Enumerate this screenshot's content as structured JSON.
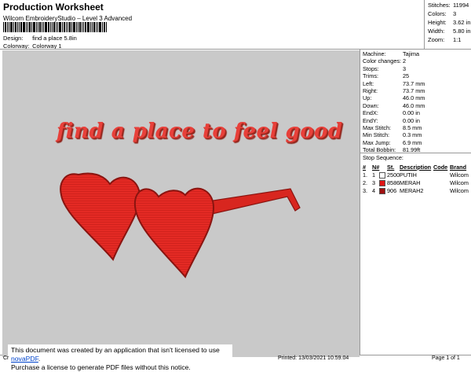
{
  "header": {
    "title": "Production Worksheet",
    "subtitle": "Wilcom EmbroideryStudio – Level 3 Advanced"
  },
  "design_info": {
    "design_label": "Design:",
    "design_value": "find a place 5.8in",
    "colorway_label": "Colorway:",
    "colorway_value": "Colorway 1"
  },
  "stats": [
    {
      "label": "Stitches:",
      "value": "11994"
    },
    {
      "label": "Colors:",
      "value": "3"
    },
    {
      "label": "Height:",
      "value": "3.62 in"
    },
    {
      "label": "Width:",
      "value": "5.80 in"
    },
    {
      "label": "Zoom:",
      "value": "1:1"
    }
  ],
  "design_text": "find a place to feel good",
  "machine_info": [
    {
      "label": "Machine:",
      "value": "Tajima"
    },
    {
      "label": "Color changes:",
      "value": "2"
    },
    {
      "label": "Stops:",
      "value": "3"
    },
    {
      "label": "Trims:",
      "value": "25"
    },
    {
      "label": "Left:",
      "value": "73.7 mm"
    },
    {
      "label": "Right:",
      "value": "73.7 mm"
    },
    {
      "label": "Up:",
      "value": "46.0 mm"
    },
    {
      "label": "Down:",
      "value": "46.0 mm"
    },
    {
      "label": "EndX:",
      "value": "0.00 in"
    },
    {
      "label": "EndY:",
      "value": "0.00 in"
    },
    {
      "label": "Max Stitch:",
      "value": "8.5 mm"
    },
    {
      "label": "Min Stitch:",
      "value": "0.3 mm"
    },
    {
      "label": "Max Jump:",
      "value": "6.9 mm"
    },
    {
      "label": "Total Bobbin:",
      "value": "81.99ft"
    }
  ],
  "stop_sequence": {
    "title": "Stop Sequence:",
    "headers": [
      "#",
      "N#",
      "St.",
      "Description",
      "Code",
      "Brand"
    ],
    "rows": [
      {
        "num": "1.",
        "n": "1",
        "swatch": "#ffffff",
        "st": "2500",
        "desc": "PUTIH",
        "code": "",
        "brand": "Wilcom"
      },
      {
        "num": "2.",
        "n": "3",
        "swatch": "#e01414",
        "st": "8586",
        "desc": "MERAH",
        "code": "",
        "brand": "Wilcom"
      },
      {
        "num": "3.",
        "n": "4",
        "swatch": "#a01010",
        "st": "906",
        "desc": "MERAH2",
        "code": "",
        "brand": "Wilcom"
      }
    ]
  },
  "notice": {
    "line1_prefix": "This document was created by an application that isn't licensed to use ",
    "link": "novaPDF",
    "line1_suffix": ".",
    "line2": "Purchase a license to generate PDF files without this notice."
  },
  "footer": {
    "left": "Cr",
    "printed": "Printed: 13/03/2021 10.59.04",
    "page": "Page 1 of 1"
  },
  "colors": {
    "design_bg": "#c9c9c9",
    "thread_red": "#e01414",
    "thread_dark_red": "#a01010"
  }
}
